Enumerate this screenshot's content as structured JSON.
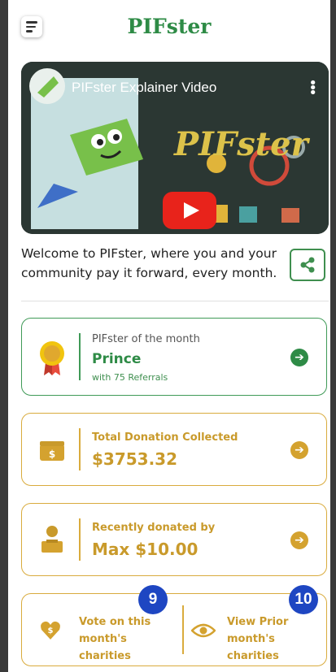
{
  "header": {
    "title": "PIFster",
    "menu_icon": "menu-icon"
  },
  "video": {
    "title": "PIFster Explainer Video",
    "overlay_text": "PIFster",
    "play_icon": "play-icon",
    "more_icon": "kebab-icon"
  },
  "welcome": {
    "text": "Welcome to PIFster, where you and your community pay it forward, every month.",
    "share_icon": "share-icon"
  },
  "cards": {
    "pifster_month": {
      "label": "PIFster of the month",
      "name": "Prince",
      "sub": "with 75 Referrals",
      "icon": "medal-icon"
    },
    "total_donation": {
      "label": "Total Donation Collected",
      "value": "$3753.32",
      "icon": "donation-box-icon"
    },
    "recent_donation": {
      "label": "Recently donated by",
      "value": "Max $10.00",
      "icon": "hand-coin-icon"
    }
  },
  "actions": {
    "vote": {
      "line1": "Vote on this",
      "line2": "month's charities",
      "badge": "9",
      "icon": "heart-dollar-icon"
    },
    "view_prior": {
      "line1": "View Prior",
      "line2": "month's charities",
      "badge": "10",
      "icon": "eye-icon"
    }
  },
  "colors": {
    "brand_green": "#2e8b46",
    "gold": "#d4a22f",
    "badge_blue": "#1e46c2"
  }
}
